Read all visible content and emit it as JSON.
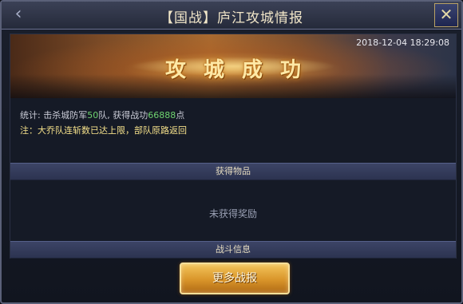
{
  "window": {
    "title": "【国战】庐江攻城情报",
    "back_icon": "‹",
    "close_icon": "✕"
  },
  "banner": {
    "title": "攻城成功",
    "timestamp": "2018-12-04 18:29:08"
  },
  "stats": {
    "prefix": "统计: 击杀城防军",
    "troops": "50",
    "middle": "队, 获得战功",
    "merit": "66888",
    "suffix": "点"
  },
  "note": "注：大乔队连斩数已达上限，部队原路返回",
  "items_section": {
    "label": "获得物品",
    "empty_text": "未获得奖励"
  },
  "battle_section": {
    "label": "战斗信息"
  },
  "more_button": {
    "label": "更多战报"
  },
  "colors": {
    "accent_gold": "#ffe9a6",
    "highlight_green": "#6fd46f",
    "note_yellow": "#f4e08a"
  }
}
